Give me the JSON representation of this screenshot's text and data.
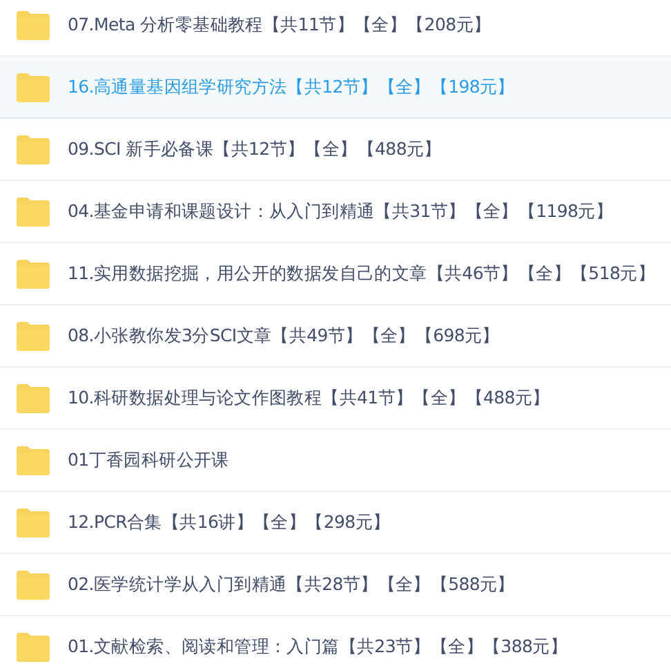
{
  "files": [
    {
      "name": "07.Meta 分析零基础教程【共11节】【全】【208元】",
      "selected": false
    },
    {
      "name": "16.高通量基因组学研究方法【共12节】【全】【198元】",
      "selected": true
    },
    {
      "name": "09.SCI 新手必备课【共12节】【全】【488元】",
      "selected": false
    },
    {
      "name": "04.基金申请和课题设计：从入门到精通【共31节】【全】【1198元】",
      "selected": false
    },
    {
      "name": "11.实用数据挖掘，用公开的数据发自己的文章【共46节】【全】【518元】",
      "selected": false
    },
    {
      "name": "08.小张教你发3分SCI文章【共49节】【全】【698元】",
      "selected": false
    },
    {
      "name": "10.科研数据处理与论文作图教程【共41节】【全】【488元】",
      "selected": false
    },
    {
      "name": "01丁香园科研公开课",
      "selected": false
    },
    {
      "name": "12.PCR合集【共16讲】【全】【298元】",
      "selected": false
    },
    {
      "name": "02.医学统计学从入门到精通【共28节】【全】【588元】",
      "selected": false
    },
    {
      "name": "01.文献检索、阅读和管理：入门篇【共23节】【全】【388元】",
      "selected": false
    }
  ]
}
